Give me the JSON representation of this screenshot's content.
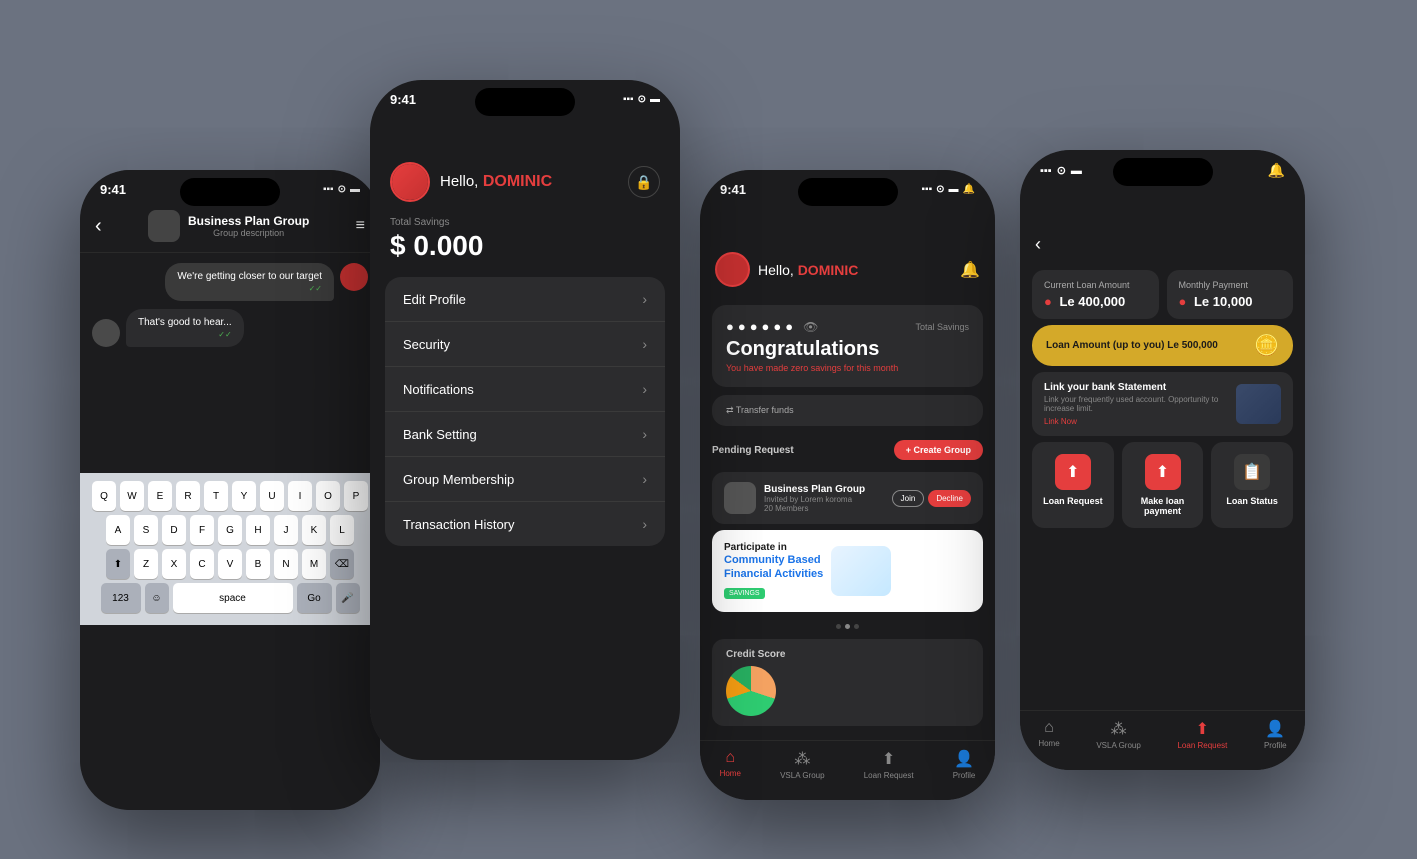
{
  "background": "#6b7280",
  "phone1": {
    "time": "9:41",
    "header": {
      "group_name": "Business Plan Group",
      "group_desc": "Group description"
    },
    "messages": [
      {
        "text": "We're getting closer to our target",
        "type": "outgoing"
      },
      {
        "text": "That's good to hear...",
        "type": "incoming"
      }
    ],
    "keyboard": {
      "rows": [
        [
          "Q",
          "W",
          "E",
          "R",
          "T",
          "Y",
          "U",
          "I",
          "O",
          "P"
        ],
        [
          "A",
          "S",
          "D",
          "F",
          "G",
          "H",
          "J",
          "K",
          "L"
        ],
        [
          "↑",
          "Z",
          "X",
          "C",
          "V",
          "B",
          "N",
          "M",
          "⌫"
        ]
      ],
      "bottom": [
        "123",
        "space",
        "Go"
      ]
    }
  },
  "phone2": {
    "time": "9:41",
    "greeting": "Hello,",
    "name": "DOMINIC",
    "savings_label": "Total Savings",
    "savings_amount": "$ 0.000",
    "menu_items": [
      "Edit Profile",
      "Security",
      "Notifications",
      "Bank Setting",
      "Group Membership",
      "Transaction History"
    ]
  },
  "phone3": {
    "time": "9:41",
    "greeting": "Hello,",
    "name": "DOMINIC",
    "masked": "●●●●●●",
    "total_savings": "Total Savings",
    "congrats": "Congratulations",
    "congrats_sub": "You have made zero savings for this month",
    "pending_request": "Pending Request",
    "create_group": "+ Create Group",
    "group": {
      "name": "Business Plan Group",
      "invited_by": "Invited by Lorem koroma",
      "members": "20 Members",
      "join": "Join",
      "decline": "Decline"
    },
    "community": {
      "text": "Participate in",
      "highlight": "Community Based Financial Activities",
      "savings_badge": "SAVINGS"
    },
    "credit_score": "Credit Score",
    "nav": [
      "Home",
      "VSLA Group",
      "Loan Request",
      "Profile"
    ]
  },
  "phone4": {
    "current_loan_label": "Current Loan Amount",
    "monthly_payment_label": "Monthly Payment",
    "current_loan_value": "Le 400,000",
    "monthly_payment_value": "Le 10,000",
    "loan_slider_text": "Loan Amount (up to you) Le 500,000",
    "bank_statement_title": "Link your bank Statement",
    "bank_statement_sub": "Link your frequently used account. Opportunity to increase limit.",
    "link_now": "Link Now",
    "actions": [
      {
        "label": "Loan Request",
        "type": "red"
      },
      {
        "label": "Make loan payment",
        "type": "red"
      },
      {
        "label": "Loan Status",
        "type": "grey"
      }
    ],
    "nav": [
      "Home",
      "VSLA Group",
      "Loan Request",
      "Profile"
    ]
  }
}
